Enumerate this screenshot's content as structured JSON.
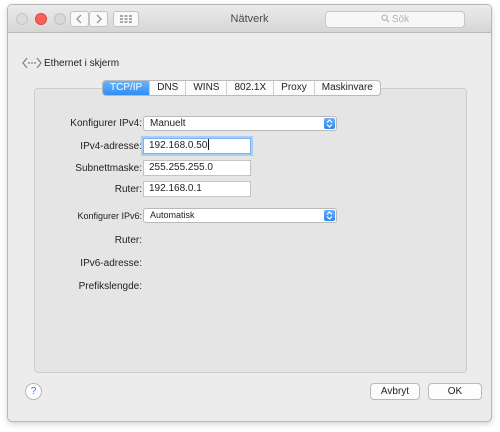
{
  "window": {
    "title": "Nätverk"
  },
  "search": {
    "placeholder": "Sök"
  },
  "icons": {
    "back": "chevron-left-icon",
    "forward": "chevron-right-icon",
    "grid": "grid-icon",
    "search": "search-icon",
    "ethernet": "ethernet-icon",
    "help": "help-icon",
    "popup_arrow": "up-down-arrow-icon"
  },
  "header": {
    "label": "Ethernet i skjerm"
  },
  "tabs": [
    {
      "label": "TCP/IP",
      "active": true
    },
    {
      "label": "DNS",
      "active": false
    },
    {
      "label": "WINS",
      "active": false
    },
    {
      "label": "802.1X",
      "active": false
    },
    {
      "label": "Proxy",
      "active": false
    },
    {
      "label": "Maskinvare",
      "active": false
    }
  ],
  "ipv4": {
    "configure_label": "Konfigurer IPv4:",
    "configure_value": "Manuelt",
    "address_label": "IPv4-adresse:",
    "address_value": "192.168.0.50",
    "subnet_label": "Subnettmaske:",
    "subnet_value": "255.255.255.0",
    "router_label": "Ruter:",
    "router_value": "192.168.0.1"
  },
  "ipv6": {
    "configure_label": "Konfigurer IPv6:",
    "configure_value": "Automatisk",
    "router_label": "Ruter:",
    "address_label": "IPv6-adresse:",
    "prefix_label": "Prefikslengde:"
  },
  "buttons": {
    "help": "?",
    "cancel": "Avbryt",
    "ok": "OK"
  },
  "colors": {
    "accent": "#2f8df5",
    "close_light": "#ff5f57",
    "focus_ring": "#a9cdf4"
  }
}
